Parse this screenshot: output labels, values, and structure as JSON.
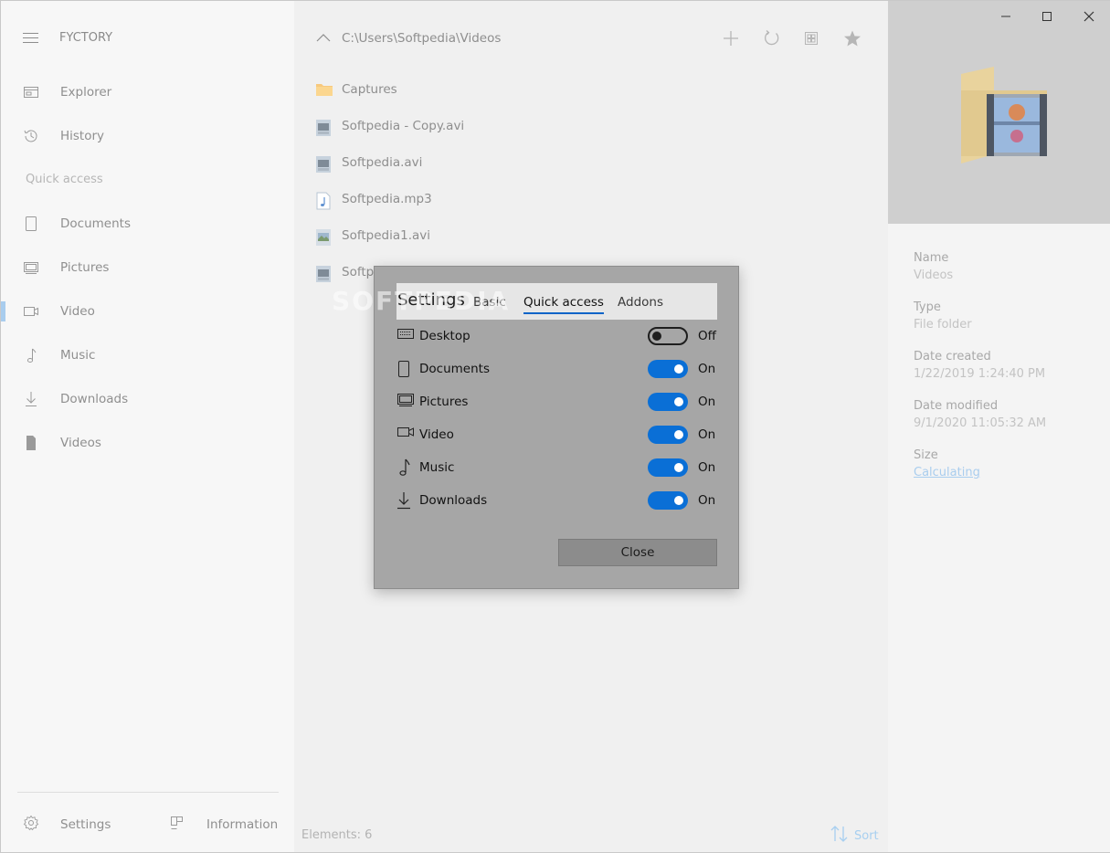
{
  "app": {
    "title": "FYCTORY"
  },
  "sidebar": {
    "items": [
      {
        "label": "Explorer",
        "icon": "explorer-icon"
      },
      {
        "label": "History",
        "icon": "history-icon"
      }
    ],
    "quick_access_header": "Quick access",
    "quick_access": [
      {
        "label": "Documents",
        "icon": "document-icon"
      },
      {
        "label": "Pictures",
        "icon": "pictures-icon"
      },
      {
        "label": "Video",
        "icon": "video-icon",
        "active": true
      },
      {
        "label": "Music",
        "icon": "music-icon"
      },
      {
        "label": "Downloads",
        "icon": "download-icon"
      },
      {
        "label": "Videos",
        "icon": "videos-folder-icon"
      }
    ],
    "footer": {
      "settings_label": "Settings",
      "information_label": "Information"
    }
  },
  "main": {
    "path": "C:\\Users\\Softpedia\\Videos",
    "toolbar": [
      "add-icon",
      "refresh-icon",
      "view-grid-icon",
      "star-icon"
    ],
    "files": [
      {
        "name": "Captures",
        "icon": "folder-icon"
      },
      {
        "name": "Softpedia - Copy.avi",
        "icon": "video-file-icon"
      },
      {
        "name": "Softpedia.avi",
        "icon": "video-file-icon"
      },
      {
        "name": "Softpedia.mp3",
        "icon": "audio-file-icon"
      },
      {
        "name": "Softpedia1.avi",
        "icon": "video-file-icon"
      },
      {
        "name": "Softpe",
        "icon": "video-file-icon"
      }
    ],
    "elements_count": "Elements: 6",
    "sort_label": "Sort"
  },
  "details": {
    "name_label": "Name",
    "name_value": "Videos",
    "type_label": "Type",
    "type_value": "File folder",
    "created_label": "Date created",
    "created_value": "1/22/2019 1:24:40 PM",
    "modified_label": "Date modified",
    "modified_value": "9/1/2020 11:05:32 AM",
    "size_label": "Size",
    "size_value": "Calculating"
  },
  "watermark": "SOFTPEDIA",
  "dialog": {
    "title": "Settings",
    "tabs": [
      {
        "label": "Basic"
      },
      {
        "label": "Quick access",
        "active": true
      },
      {
        "label": "Addons"
      }
    ],
    "rows": [
      {
        "label": "Desktop",
        "icon": "desktop-icon",
        "state": "Off"
      },
      {
        "label": "Documents",
        "icon": "document-icon",
        "state": "On"
      },
      {
        "label": "Pictures",
        "icon": "pictures-icon",
        "state": "On"
      },
      {
        "label": "Video",
        "icon": "video-icon",
        "state": "On"
      },
      {
        "label": "Music",
        "icon": "music-icon",
        "state": "On"
      },
      {
        "label": "Downloads",
        "icon": "download-icon",
        "state": "On"
      }
    ],
    "close_label": "Close"
  },
  "colors": {
    "accent": "#0a6fd6",
    "dialog_bg": "#a6a6a6",
    "link": "#a9cdee"
  }
}
